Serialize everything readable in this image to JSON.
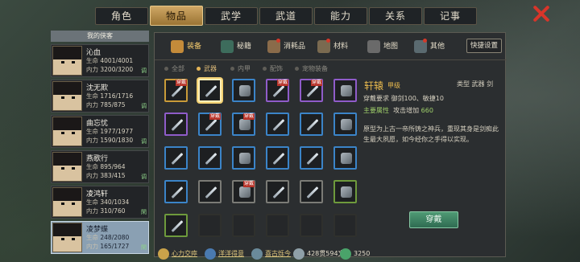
{
  "tabs": [
    {
      "label": "角色",
      "dot": false
    },
    {
      "label": "物品",
      "dot": true
    },
    {
      "label": "武学",
      "dot": true
    },
    {
      "label": "武道",
      "dot": false
    },
    {
      "label": "能力",
      "dot": false
    },
    {
      "label": "关系",
      "dot": false
    },
    {
      "label": "记事",
      "dot": false
    }
  ],
  "active_tab": 1,
  "sidebar": {
    "title": "我的侠客",
    "hp_label": "生命",
    "mp_label": "内力",
    "chars": [
      {
        "name": "沁血",
        "hp": "4001/4001",
        "mp": "3200/3200",
        "tag": "调"
      },
      {
        "name": "沈无欺",
        "hp": "1716/1716",
        "mp": "785/875",
        "tag": "调"
      },
      {
        "name": "曲忘忧",
        "hp": "1977/1977",
        "mp": "1590/1830",
        "tag": "调"
      },
      {
        "name": "燕歌行",
        "hp": "895/964",
        "mp": "383/415",
        "tag": "调"
      },
      {
        "name": "凌鸿轩",
        "hp": "340/1034",
        "mp": "310/760",
        "tag": "閑"
      },
      {
        "name": "凌梦蝶",
        "hp": "248/2080",
        "mp": "165/1727",
        "tag": "閑"
      }
    ]
  },
  "subtabs": [
    {
      "label": "装备",
      "icon": "equip-icon",
      "color": "#c48b3a",
      "dot": false
    },
    {
      "label": "秘籍",
      "icon": "book-icon",
      "color": "#3d6c5c",
      "dot": false
    },
    {
      "label": "消耗品",
      "icon": "potion-icon",
      "color": "#8a6b4a",
      "dot": true
    },
    {
      "label": "材料",
      "icon": "material-icon",
      "color": "#7a6a50",
      "dot": true
    },
    {
      "label": "地图",
      "icon": "map-icon",
      "color": "#6a6a6a",
      "dot": false
    },
    {
      "label": "其他",
      "icon": "other-icon",
      "color": "#5a6a70",
      "dot": true
    }
  ],
  "quick_settings": "快捷设置",
  "filters": [
    "全部",
    "武器",
    "内甲",
    "配饰",
    "宠物装备"
  ],
  "active_filter": 1,
  "slots": [
    {
      "c": "yel",
      "w": 1
    },
    {
      "c": "yel",
      "w": 0
    },
    {
      "c": "blu",
      "w": 0
    },
    {
      "c": "pur",
      "w": 1
    },
    {
      "c": "pur",
      "w": 1
    },
    {
      "c": "pur",
      "w": 0
    },
    {
      "c": "pur",
      "w": 0
    },
    {
      "c": "blu",
      "w": 1
    },
    {
      "c": "blu",
      "w": 1
    },
    {
      "c": "blu",
      "w": 0
    },
    {
      "c": "blu",
      "w": 0
    },
    {
      "c": "blu",
      "w": 0
    },
    {
      "c": "blu",
      "w": 0
    },
    {
      "c": "blu",
      "w": 0
    },
    {
      "c": "blu",
      "w": 0
    },
    {
      "c": "blu",
      "w": 0
    },
    {
      "c": "blu",
      "w": 0
    },
    {
      "c": "blu",
      "w": 0
    },
    {
      "c": "blu",
      "w": 0
    },
    {
      "c": "gray",
      "w": 0
    },
    {
      "c": "gray",
      "w": 1
    },
    {
      "c": "gray",
      "w": 0
    },
    {
      "c": "gray",
      "w": 0
    },
    {
      "c": "grn",
      "w": 0
    },
    {
      "c": "grn",
      "w": 0
    },
    {
      "c": "empty",
      "w": 0
    },
    {
      "c": "empty",
      "w": 0
    },
    {
      "c": "empty",
      "w": 0
    },
    {
      "c": "empty",
      "w": 0
    },
    {
      "c": "empty",
      "w": 0
    }
  ],
  "wear_tag": "穿戴",
  "detail": {
    "name": "轩辕",
    "grade": "甲级",
    "type": "类型 武器 剑",
    "req": "穿戴要求  御剑100、敏捷10",
    "attr_label": "主要属性",
    "attr_text": "攻击增加",
    "attr_val": "660",
    "desc": "原型为上古一帝所铸之神兵，重现其身是剑痴此生最大夙愿，如今经你之手得以实现。",
    "equip_label": "穿戴"
  },
  "bottom": [
    {
      "label": "心力交瘁",
      "color": "#c9a24a",
      "u": true
    },
    {
      "label": "洋洋得意",
      "color": "#4a7ab0",
      "u": true
    },
    {
      "label": "喜古烁今",
      "color": "#6a8a9a",
      "u": true
    },
    {
      "label": "428贯594文",
      "color": "#8fa0a8",
      "u": false
    },
    {
      "label": "3250",
      "color": "#4aa36a",
      "u": false
    }
  ]
}
